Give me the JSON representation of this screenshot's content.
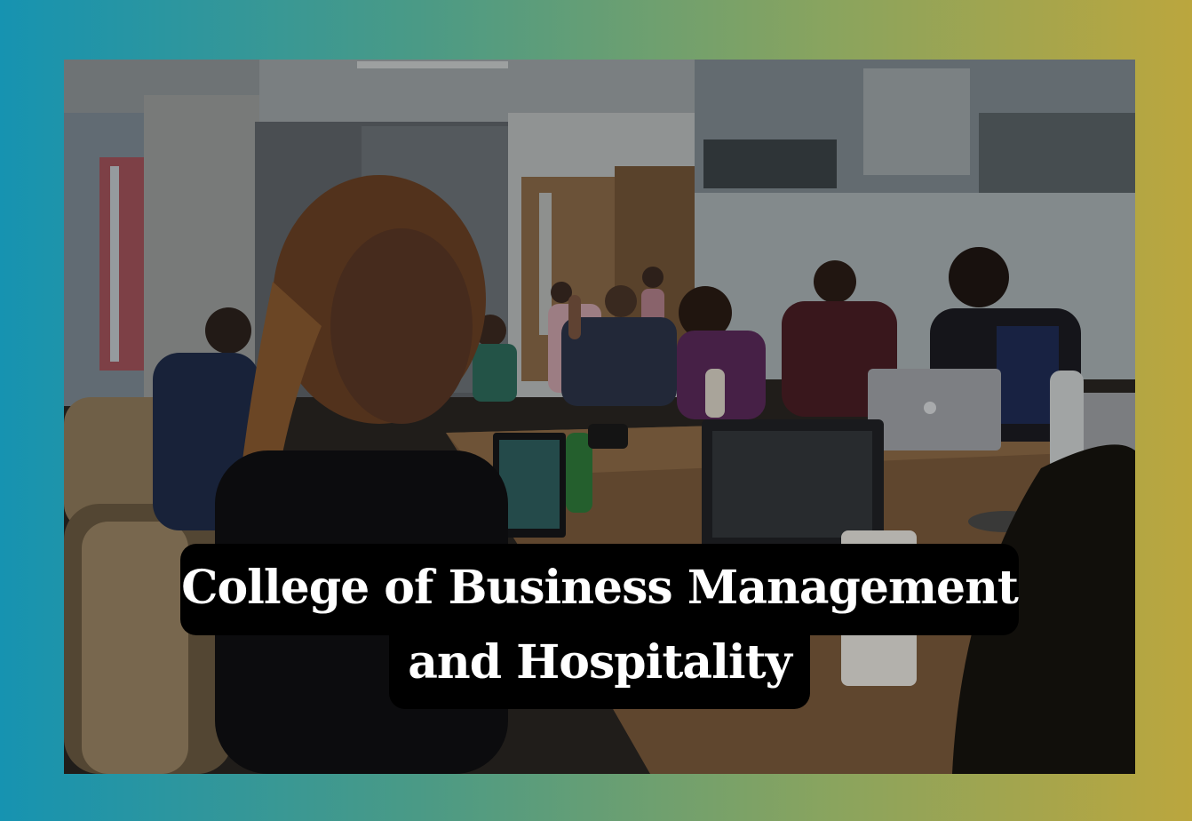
{
  "banner": {
    "line1": "College of Business Management",
    "line2": "and Hospitality"
  },
  "photo": {
    "laptop_logo": "apple-logo"
  },
  "colors": {
    "gradient_left": "#1693b1",
    "gradient_right": "#bba63e",
    "title_bg": "#000000",
    "title_text": "#ffffff"
  }
}
